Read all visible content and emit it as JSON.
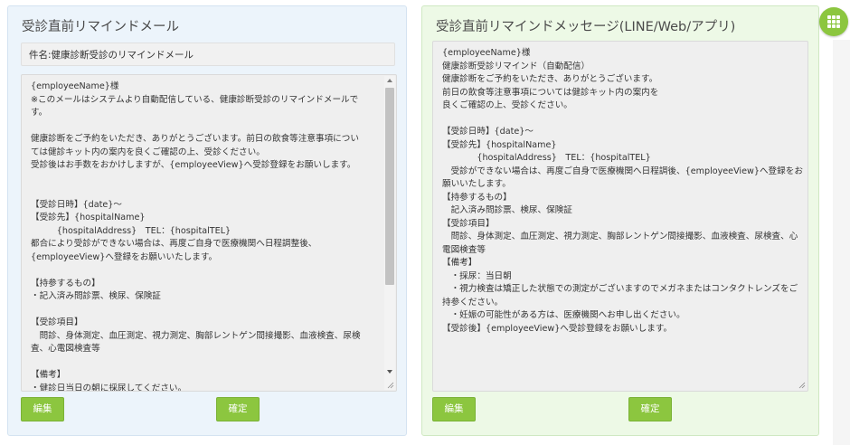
{
  "email_panel": {
    "title": "受診直前リマインドメール",
    "subject": "件名:健康診断受診のリマインドメール",
    "body": "{employeeName}様\n※このメールはシステムより自動配信している、健康診断受診のリマインドメールで\nす。\n\n健康診断をご予約をいただき、ありがとうございます。前日の飲食等注意事項につい\nては健診キット内の案内を良くご確認の上、受診ください。\n受診後はお手数をおかけしますが、{employeeView}へ受診登録をお願いします。\n\n\n【受診日時】{date}～\n【受診先】{hospitalName}\n　　　{hospitalAddress}　TEL：{hospitalTEL}\n都合により受診ができない場合は、再度ご自身で医療機関へ日程調整後、\n{employeeView}へ登録をお願いいたします。\n\n【持参するもの】\n・記入済み問診票、検尿、保険証\n\n【受診項目】\n　問診、身体測定、血圧測定、視力測定、胸部レントゲン間接撮影、血液検査、尿検\n査、心電図検査等\n\n【備考】\n・健診日当日の朝に採尿してください。\n・視力検査は矯正した状態での測定がございますので、メガネ",
    "edit_label": "編集",
    "confirm_label": "確定"
  },
  "message_panel": {
    "title": "受診直前リマインドメッセージ(LINE/Web/アプリ)",
    "body": "{employeeName}様\n健康診断受診リマインド（自動配信）\n健康診断をご予約をいただき、ありがとうございます。\n前日の飲食等注意事項については健診キット内の案内を\n良くご確認の上、受診ください。\n\n【受診日時】{date}～\n【受診先】{hospitalName}\n　　　　{hospitalAddress}　TEL：{hospitalTEL}\n　受診ができない場合は、再度ご自身で医療機関へ日程調後、{employeeView}へ登録をお\n願いいたします。\n【持参するもの】\n　記入済み問診票、検尿、保険証\n【受診項目】\n　問診、身体測定、血圧測定、視力測定、胸部レントゲン間接撮影、血液検査、尿検査、心\n電図検査等\n【備考】\n　・採尿：当日朝\n　・視力検査は矯正した状態での測定がございますのでメガネまたはコンタクトレンズをご\n持参ください。\n　・妊娠の可能性がある方は、医療機関へお申し出ください。\n【受診後】{employeeView}へ受診登録をお願いします。",
    "edit_label": "編集",
    "confirm_label": "確定"
  },
  "colors": {
    "accent_green": "#8cc63f",
    "email_panel_bg": "#ecf4fb",
    "message_panel_bg": "#edf9e6"
  },
  "icons": {
    "app_menu": "grid-icon"
  }
}
